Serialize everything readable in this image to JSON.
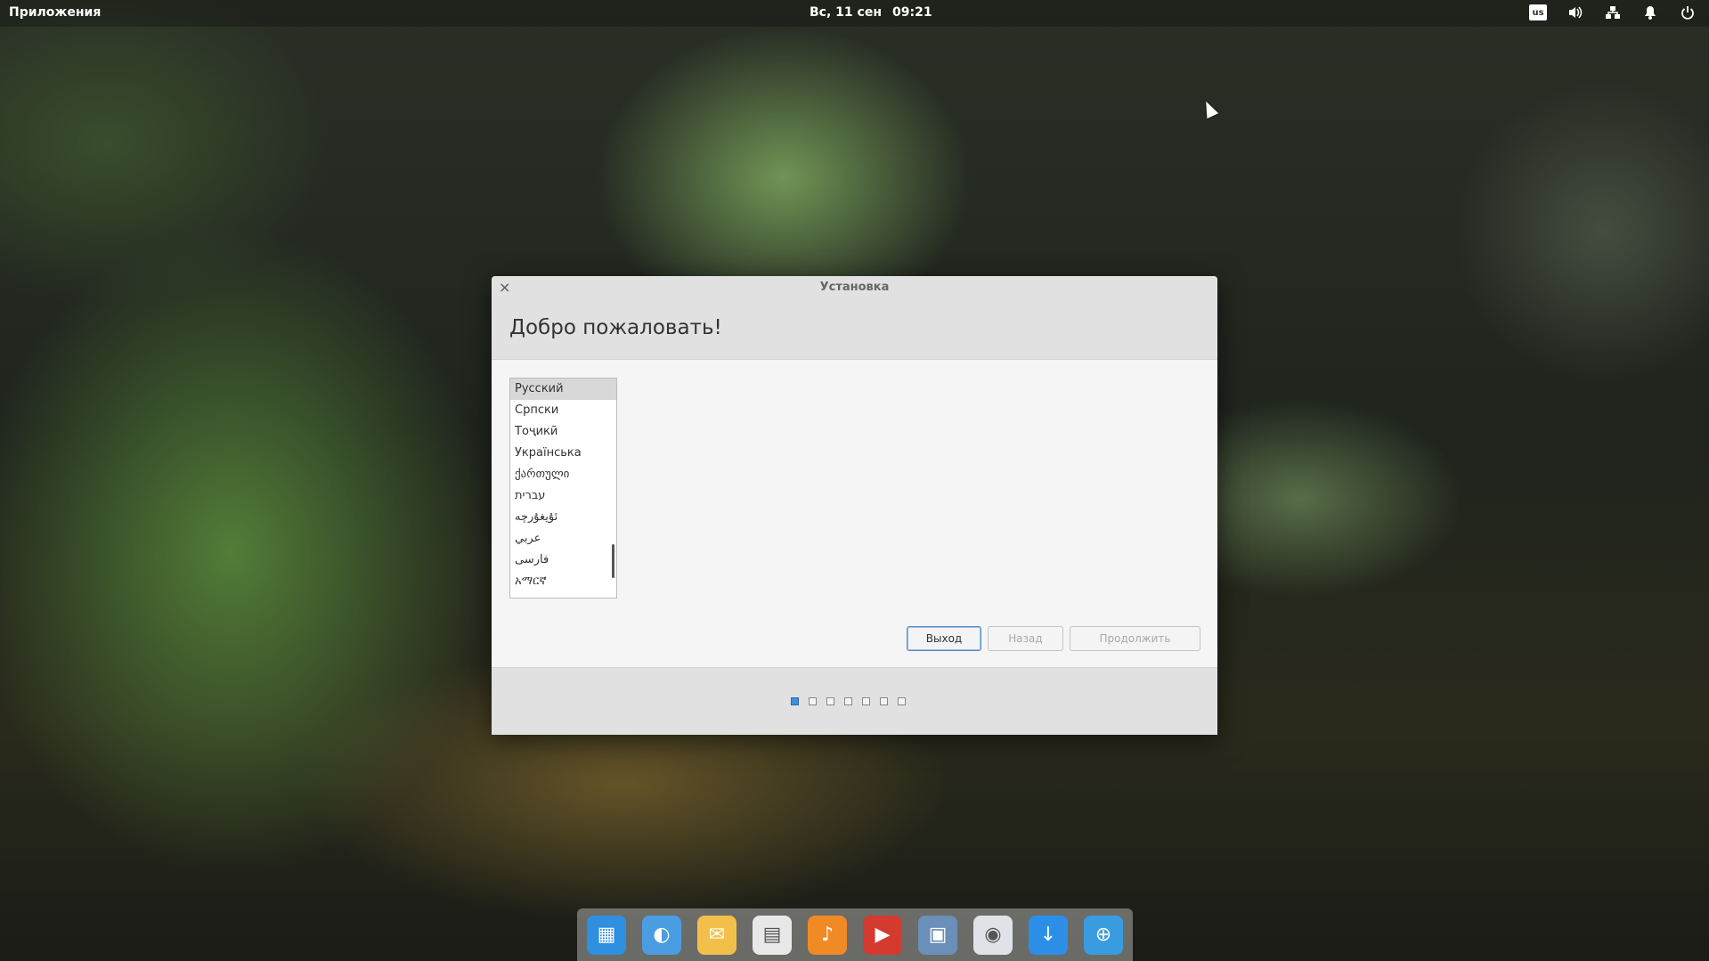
{
  "panel": {
    "applications_label": "Приложения",
    "date": "Вс, 11 сен",
    "time": "09:21",
    "keyboard_layout": "us"
  },
  "window": {
    "title": "Установка",
    "heading": "Добро пожаловать!",
    "languages": [
      "Русский",
      "Српски",
      "Тоҷикӣ",
      "Українська",
      "ქართული",
      "עברית",
      "ئۇيغۇرچە",
      "عربي",
      "فارسی",
      "አማርኛ"
    ],
    "selected_language": "Русский",
    "buttons": {
      "quit": "Выход",
      "back": "Назад",
      "continue": "Продолжить"
    },
    "progress": {
      "steps": 7,
      "current": 1
    }
  },
  "dock": {
    "apps": [
      {
        "icon": "multitasking-view-icon",
        "color": "#2f8fe0"
      },
      {
        "icon": "web-browser-icon",
        "color": "#4a9de0"
      },
      {
        "icon": "mail-icon",
        "color": "#f2c04a"
      },
      {
        "icon": "calendar-icon",
        "color": "#e8e8e8"
      },
      {
        "icon": "music-icon",
        "color": "#f08a24"
      },
      {
        "icon": "videos-icon",
        "color": "#d53a2e"
      },
      {
        "icon": "photos-icon",
        "color": "#6a8fb8"
      },
      {
        "icon": "settings-icon",
        "color": "#dfe3e8"
      },
      {
        "icon": "appcenter-icon",
        "color": "#2b8fe8"
      },
      {
        "icon": "installer-icon",
        "color": "#3a9ce0"
      }
    ]
  },
  "colors": {
    "accent": "#3d8fe0",
    "window_bg": "#f5f5f5",
    "header_bg": "#e1e1e1"
  }
}
